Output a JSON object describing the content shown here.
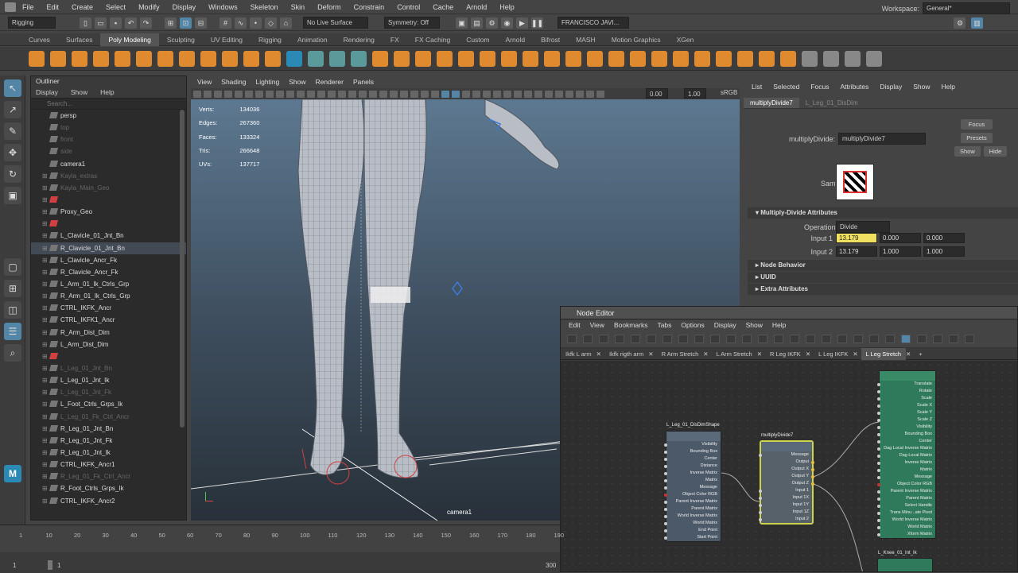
{
  "menubar": {
    "items": [
      "File",
      "Edit",
      "Create",
      "Select",
      "Modify",
      "Display",
      "Windows",
      "Skeleton",
      "Skin",
      "Deform",
      "Constrain",
      "Control",
      "Cache",
      "Arnold",
      "Help"
    ],
    "workspace_label": "Workspace:",
    "workspace_value": "General*"
  },
  "statusline": {
    "mode": "Rigging",
    "live_surface": "No Live Surface",
    "symmetry": "Symmetry: Off",
    "user": "FRANCISCO JAVI..."
  },
  "shelf_tabs": [
    "Curves",
    "Surfaces",
    "Poly Modeling",
    "Sculpting",
    "UV Editing",
    "Rigging",
    "Animation",
    "Rendering",
    "FX",
    "FX Caching",
    "Custom",
    "Arnold",
    "Bifrost",
    "MASH",
    "Motion Graphics",
    "XGen"
  ],
  "shelf_active": "Poly Modeling",
  "outliner": {
    "title": "Outliner",
    "menu": [
      "Display",
      "Show",
      "Help"
    ],
    "search_placeholder": "Search...",
    "items": [
      {
        "label": "persp",
        "style": "cam"
      },
      {
        "label": "top",
        "style": "dimcam"
      },
      {
        "label": "front",
        "style": "dimcam"
      },
      {
        "label": "side",
        "style": "dimcam"
      },
      {
        "label": "camera1",
        "style": "cam"
      },
      {
        "label": "Kayla_extras",
        "style": "dim"
      },
      {
        "label": "Kayla_Main_Geo",
        "style": "dim"
      },
      {
        "label": "",
        "style": "red"
      },
      {
        "label": "Proxy_Geo",
        "style": "norm"
      },
      {
        "label": "",
        "style": "red"
      },
      {
        "label": "L_Clavicle_01_Jnt_Bn",
        "style": "norm"
      },
      {
        "label": "R_Clavicle_01_Jnt_Bn",
        "style": "sel"
      },
      {
        "label": "L_Clavicle_Ancr_Fk",
        "style": "norm"
      },
      {
        "label": "R_Clavicle_Ancr_Fk",
        "style": "norm"
      },
      {
        "label": "L_Arm_01_Ik_Ctrls_Grp",
        "style": "norm"
      },
      {
        "label": "R_Arm_01_Ik_Ctrls_Grp",
        "style": "norm"
      },
      {
        "label": "CTRL_IKFK_Ancr",
        "style": "norm"
      },
      {
        "label": "CTRL_IKFK1_Ancr",
        "style": "norm"
      },
      {
        "label": "R_Arm_Dist_Dim",
        "style": "norm"
      },
      {
        "label": "L_Arm_Dist_Dim",
        "style": "norm"
      },
      {
        "label": "",
        "style": "red"
      },
      {
        "label": "L_Leg_01_Jnt_Bn",
        "style": "dim"
      },
      {
        "label": "L_Leg_01_Jnt_Ik",
        "style": "norm"
      },
      {
        "label": "L_Leg_01_Jnt_Fk",
        "style": "dim"
      },
      {
        "label": "L_Foot_Ctrls_Grps_Ik",
        "style": "norm"
      },
      {
        "label": "L_Leg_01_Fk_Ctrl_Ancr",
        "style": "dim"
      },
      {
        "label": "R_Leg_01_Jnt_Bn",
        "style": "norm"
      },
      {
        "label": "R_Leg_01_Jnt_Fk",
        "style": "norm"
      },
      {
        "label": "R_Leg_01_Jnt_Ik",
        "style": "norm"
      },
      {
        "label": "CTRL_IKFK_Ancr1",
        "style": "norm"
      },
      {
        "label": "R_Leg_01_Fk_Ctrl_Ancr",
        "style": "dim"
      },
      {
        "label": "R_Foot_Ctrls_Grps_Ik",
        "style": "norm"
      },
      {
        "label": "CTRL_IKFK_Ancr2",
        "style": "norm"
      }
    ]
  },
  "viewport": {
    "menu": [
      "View",
      "Shading",
      "Lighting",
      "Show",
      "Renderer",
      "Panels"
    ],
    "near": "0.00",
    "far": "1.00",
    "color_space": "sRGB",
    "camera_label": "camera1",
    "hud": [
      {
        "k": "Verts:",
        "v": "134036"
      },
      {
        "k": "Edges:",
        "v": "267360"
      },
      {
        "k": "Faces:",
        "v": "133324"
      },
      {
        "k": "Tris:",
        "v": "266648"
      },
      {
        "k": "UVs:",
        "v": "137717"
      }
    ]
  },
  "attr": {
    "menu": [
      "List",
      "Selected",
      "Focus",
      "Attributes",
      "Display",
      "Show",
      "Help"
    ],
    "tabs": [
      "multiplyDivide7",
      "L_Leg_01_DisDim"
    ],
    "node_label": "multiplyDivide:",
    "node_value": "multiplyDivide7",
    "focus": "Focus",
    "presets": "Presets",
    "show": "Show",
    "hide": "Hide",
    "sample_label": "Sample",
    "section": "Multiply-Divide Attributes",
    "op_label": "Operation",
    "op_value": "Divide",
    "input1_label": "Input 1",
    "input1": [
      "13.179",
      "0.000",
      "0.000"
    ],
    "input2_label": "Input 2",
    "input2": [
      "13.179",
      "1.000",
      "1.000"
    ],
    "collapsed": [
      "Node Behavior",
      "UUID",
      "Extra Attributes"
    ]
  },
  "node_editor": {
    "title": "Node Editor",
    "menu": [
      "Edit",
      "View",
      "Bookmarks",
      "Tabs",
      "Options",
      "Display",
      "Show",
      "Help"
    ],
    "tabs": [
      "Ikfk L arm",
      "Ikfk rigth arm",
      "R Arm Stretch",
      "L Arm Stretch",
      "R Leg IKFK",
      "L Leg IKFK",
      "L Leg Stretch"
    ],
    "active_tab": "L Leg Stretch",
    "node1": {
      "title": "L_Leg_01_DisDimShape",
      "ports": [
        "Visibility",
        "Bounding Box",
        "Center",
        "Distance",
        "Inverse Matrix",
        "Matrix",
        "Message",
        "Object Color RGB",
        "Parent Inverse Matrix",
        "Parent Matrix",
        "World Inverse Matrix",
        "World Matrix",
        "End Point",
        "Start Point"
      ]
    },
    "node2": {
      "title": "multiplyDivide7",
      "ports": [
        "Message",
        "Output",
        "Output X",
        "Output Y",
        "Output Z",
        "Input 1",
        "Input 1X",
        "Input 1Y",
        "Input 1Z",
        "Input 2"
      ]
    },
    "node3": {
      "ports": [
        "Translate",
        "Rotate",
        "Scale",
        "Scale X",
        "Scale Y",
        "Scale Z",
        "Visibility",
        "Bounding Box",
        "Center",
        "Dag Local Inverse Matrix",
        "Dag Local Matrix",
        "Inverse Matrix",
        "Matrix",
        "Message",
        "Object Color RGB",
        "Parent Inverse Matrix",
        "Parent Matrix",
        "Select Handle",
        "Trans Minu...ate Pivot",
        "World Inverse Matrix",
        "World Matrix",
        "Xform Matrix"
      ]
    },
    "node4": {
      "title": "L_Knee_01_Int_Ik"
    }
  },
  "timeline": {
    "ticks": [
      "1",
      "10",
      "20",
      "30",
      "40",
      "50",
      "60",
      "70",
      "80",
      "90",
      "100",
      "110",
      "120",
      "130",
      "140",
      "150",
      "160",
      "170",
      "180",
      "190"
    ],
    "range_start": "1",
    "range_start2": "1",
    "range_end": "300"
  },
  "colors": {
    "accent": "#5285a6",
    "highlight": "#f0e060",
    "node_green": "#2f7a5a",
    "shelf_orange": "#e08a30"
  }
}
